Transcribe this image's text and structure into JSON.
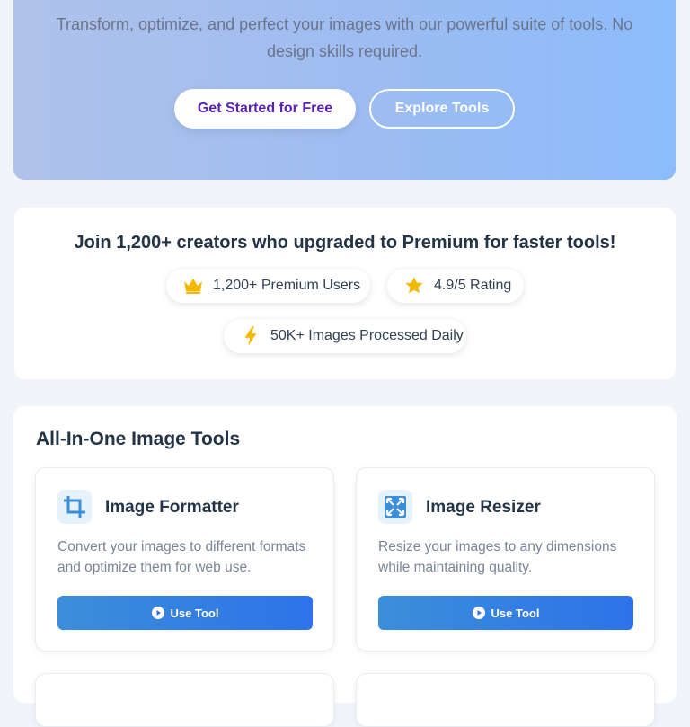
{
  "hero": {
    "subtitle": "Transform, optimize, and perfect your images with our powerful suite of tools. No design skills required.",
    "primary_cta": "Get Started for Free",
    "secondary_cta": "Explore Tools"
  },
  "social_proof": {
    "title": "Join 1,200+ creators who upgraded to Premium for faster tools!",
    "stats": [
      {
        "icon": "crown-icon",
        "label": "1,200+ Premium Users"
      },
      {
        "icon": "star-icon",
        "label": "4.9/5 Rating"
      },
      {
        "icon": "bolt-icon",
        "label": "50K+ Images Processed Daily"
      }
    ]
  },
  "tools": {
    "title": "All-In-One Image Tools",
    "items": [
      {
        "icon": "crop-icon",
        "name": "Image Formatter",
        "description": "Convert your images to different formats and optimize them for web use.",
        "button": "Use Tool"
      },
      {
        "icon": "expand-icon",
        "name": "Image Resizer",
        "description": "Resize your images to any dimensions while maintaining quality.",
        "button": "Use Tool"
      }
    ]
  },
  "colors": {
    "accent_blue": "#2d72ea",
    "primary_text_purple": "#5b21b6",
    "crown": "#f5b800",
    "star": "#f5b800",
    "bolt": "#f5b800",
    "icon_blue": "#3b8fd9"
  }
}
